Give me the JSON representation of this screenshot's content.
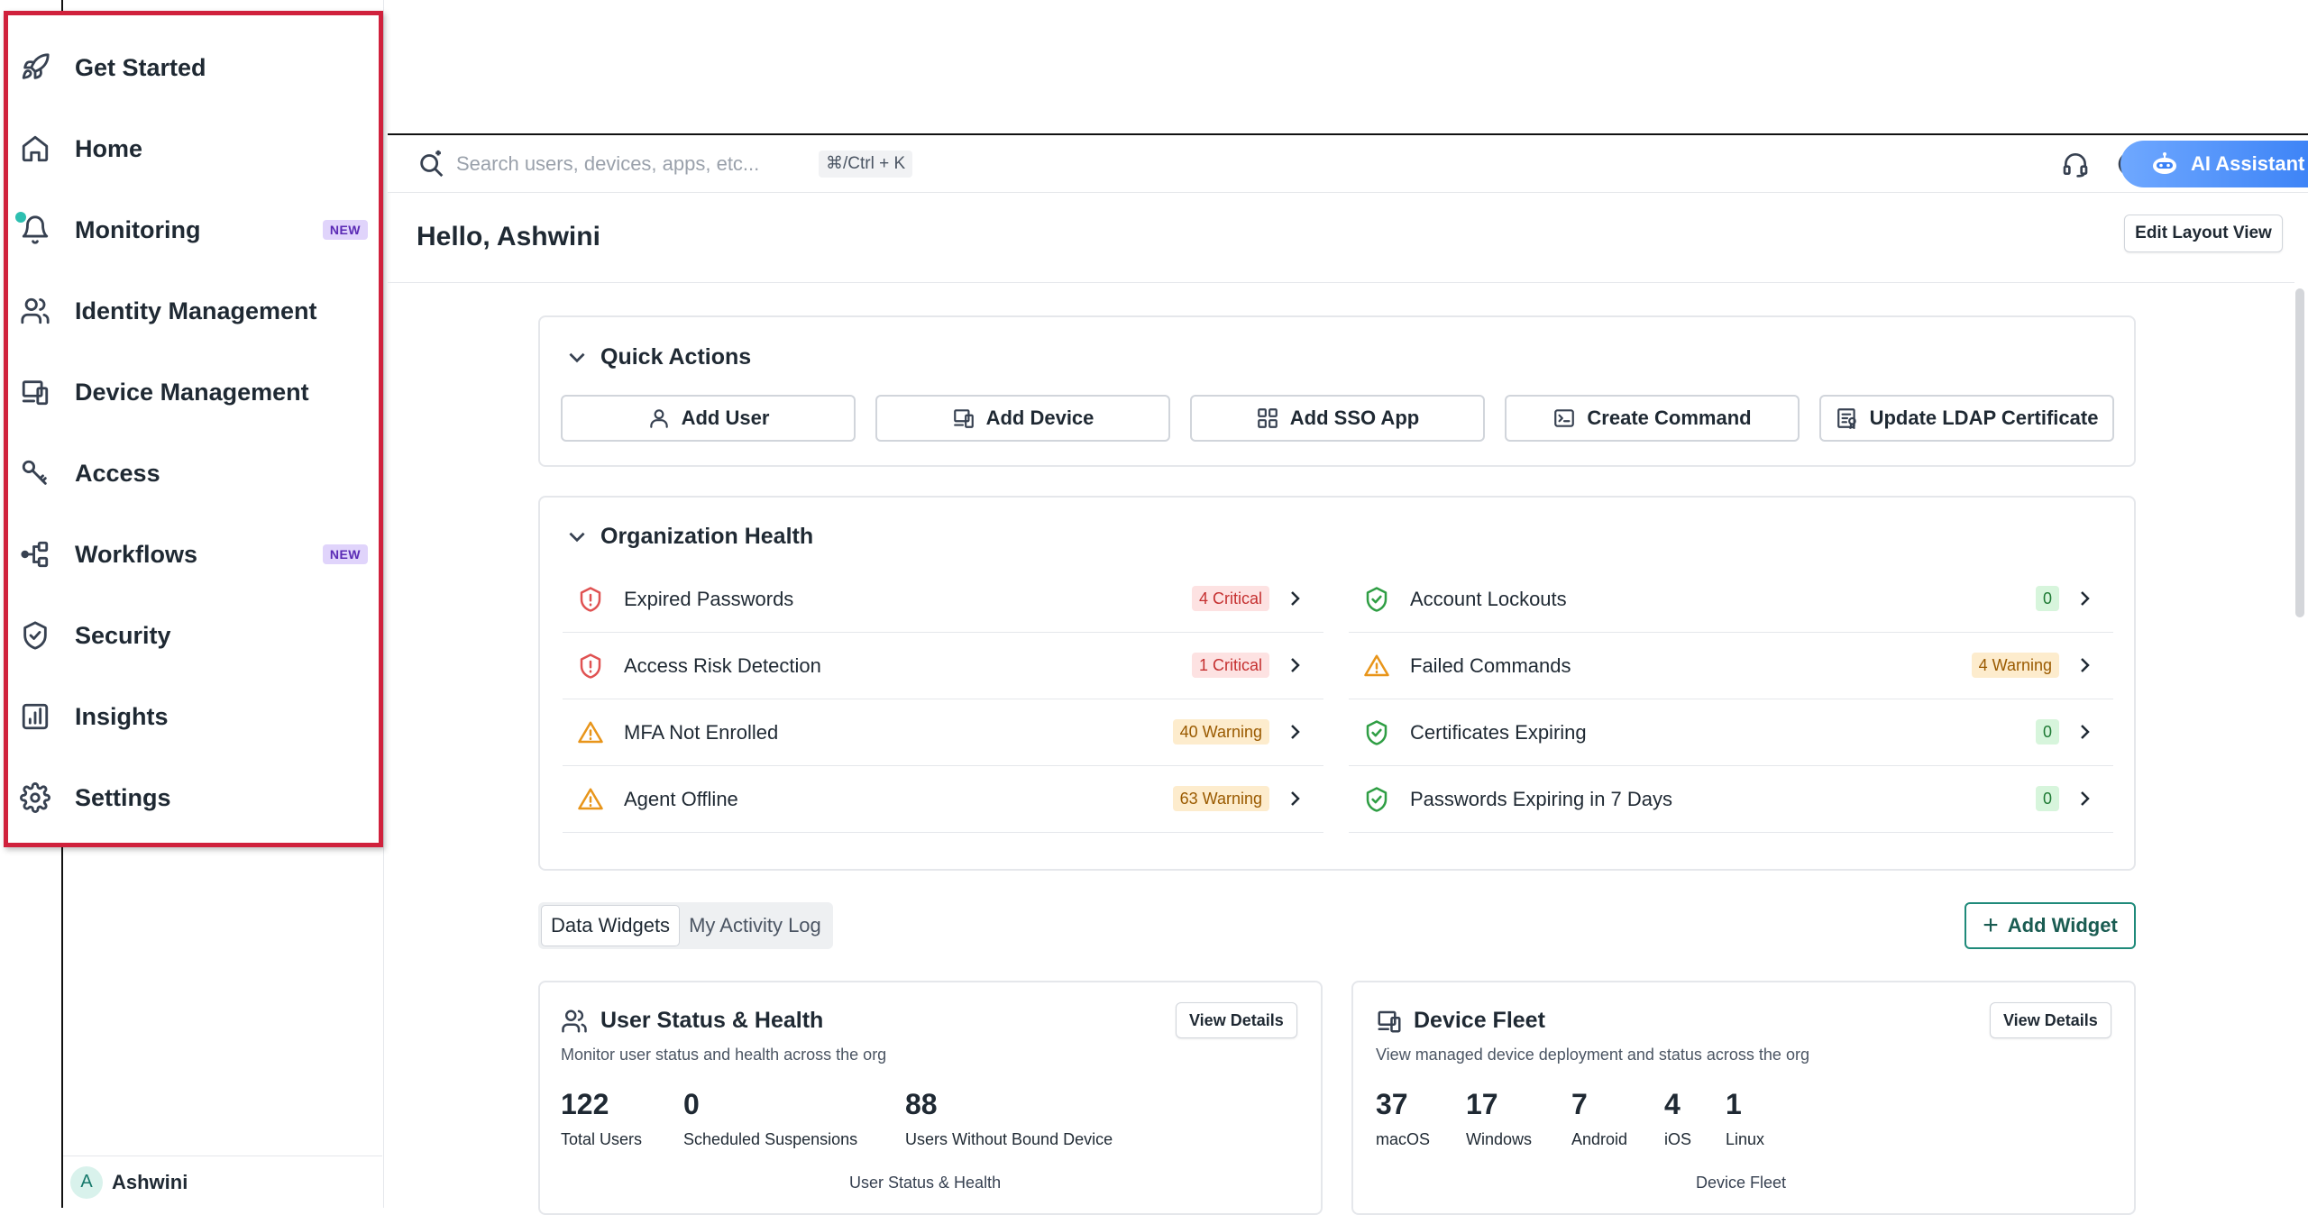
{
  "sidebar": {
    "items": [
      {
        "label": "Get Started",
        "icon": "rocket-icon"
      },
      {
        "label": "Home",
        "icon": "home-icon"
      },
      {
        "label": "Monitoring",
        "icon": "bell-icon",
        "badge": "NEW"
      },
      {
        "label": "Identity Management",
        "icon": "users-icon"
      },
      {
        "label": "Device Management",
        "icon": "devices-icon"
      },
      {
        "label": "Access",
        "icon": "key-icon"
      },
      {
        "label": "Workflows",
        "icon": "workflow-icon",
        "badge": "NEW"
      },
      {
        "label": "Security",
        "icon": "shield-icon"
      },
      {
        "label": "Insights",
        "icon": "chart-icon"
      },
      {
        "label": "Settings",
        "icon": "gear-icon"
      }
    ],
    "user": {
      "initial": "A",
      "name": "Ashwini"
    }
  },
  "topbar": {
    "search_placeholder": "Search users, devices, apps, etc...",
    "shortcut": "⌘/Ctrl + K",
    "icons": [
      "headset-icon",
      "help-lifebuoy-icon",
      "flag-icon",
      "checklist-icon"
    ],
    "ai_assistant_label": "AI Assistant"
  },
  "header": {
    "greeting": "Hello, Ashwini",
    "edit_layout_label": "Edit Layout View"
  },
  "quick_actions": {
    "title": "Quick Actions",
    "buttons": [
      {
        "label": "Add User",
        "icon": "user-icon"
      },
      {
        "label": "Add Device",
        "icon": "device-icon"
      },
      {
        "label": "Add SSO App",
        "icon": "apps-grid-icon"
      },
      {
        "label": "Create Command",
        "icon": "terminal-icon"
      },
      {
        "label": "Update LDAP Certificate",
        "icon": "certificate-icon"
      }
    ]
  },
  "org_health": {
    "title": "Organization Health",
    "left": [
      {
        "label": "Expired Passwords",
        "badge": "4 Critical",
        "status": "critical"
      },
      {
        "label": "Access Risk Detection",
        "badge": "1 Critical",
        "status": "critical"
      },
      {
        "label": "MFA Not Enrolled",
        "badge": "40 Warning",
        "status": "warning"
      },
      {
        "label": "Agent Offline",
        "badge": "63 Warning",
        "status": "warning"
      }
    ],
    "right": [
      {
        "label": "Account Lockouts",
        "badge": "0",
        "status": "ok"
      },
      {
        "label": "Failed Commands",
        "badge": "4 Warning",
        "status": "warning"
      },
      {
        "label": "Certificates Expiring",
        "badge": "0",
        "status": "ok"
      },
      {
        "label": "Passwords Expiring in 7 Days",
        "badge": "0",
        "status": "ok"
      }
    ],
    "colors": {
      "critical": "#e05252",
      "warning": "#e8951a",
      "ok": "#2f9e44"
    }
  },
  "tabs": {
    "items": [
      "Data Widgets",
      "My Activity Log"
    ],
    "active": "Data Widgets",
    "add_widget_label": "Add Widget"
  },
  "widgets": {
    "user_status": {
      "title": "User Status & Health",
      "subtitle": "Monitor user status and health across the org",
      "view_details": "View Details",
      "stats": [
        {
          "value": "122",
          "label": "Total Users"
        },
        {
          "value": "0",
          "label": "Scheduled Suspensions"
        },
        {
          "value": "88",
          "label": "Users Without Bound Device"
        }
      ],
      "footer": "User Status & Health"
    },
    "device_fleet": {
      "title": "Device Fleet",
      "subtitle": "View managed device deployment and status across the org",
      "view_details": "View Details",
      "stats": [
        {
          "value": "37",
          "label": "macOS"
        },
        {
          "value": "17",
          "label": "Windows"
        },
        {
          "value": "7",
          "label": "Android"
        },
        {
          "value": "4",
          "label": "iOS"
        },
        {
          "value": "1",
          "label": "Linux"
        }
      ],
      "footer": "Device Fleet"
    }
  }
}
